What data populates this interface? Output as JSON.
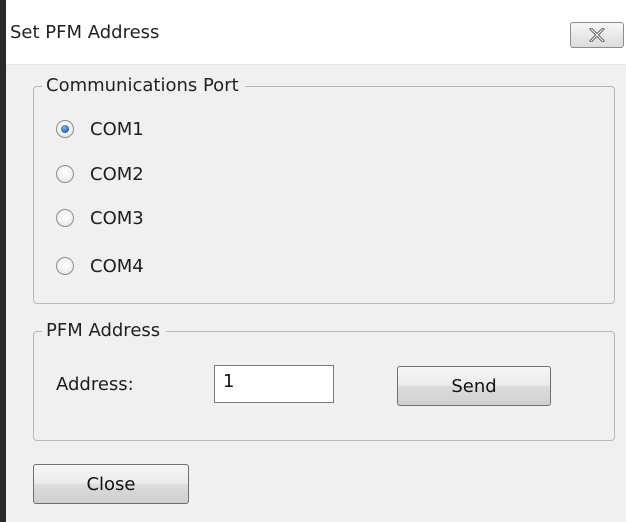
{
  "window": {
    "title": "Set PFM Address",
    "close_icon": "close-icon"
  },
  "port_group": {
    "legend": "Communications Port",
    "options": [
      {
        "label": "COM1",
        "checked": true
      },
      {
        "label": "COM2",
        "checked": false
      },
      {
        "label": "COM3",
        "checked": false
      },
      {
        "label": "COM4",
        "checked": false
      }
    ]
  },
  "address_group": {
    "legend": "PFM Address",
    "address_label": "Address:",
    "address_value": "1",
    "send_label": "Send"
  },
  "footer": {
    "close_label": "Close"
  }
}
